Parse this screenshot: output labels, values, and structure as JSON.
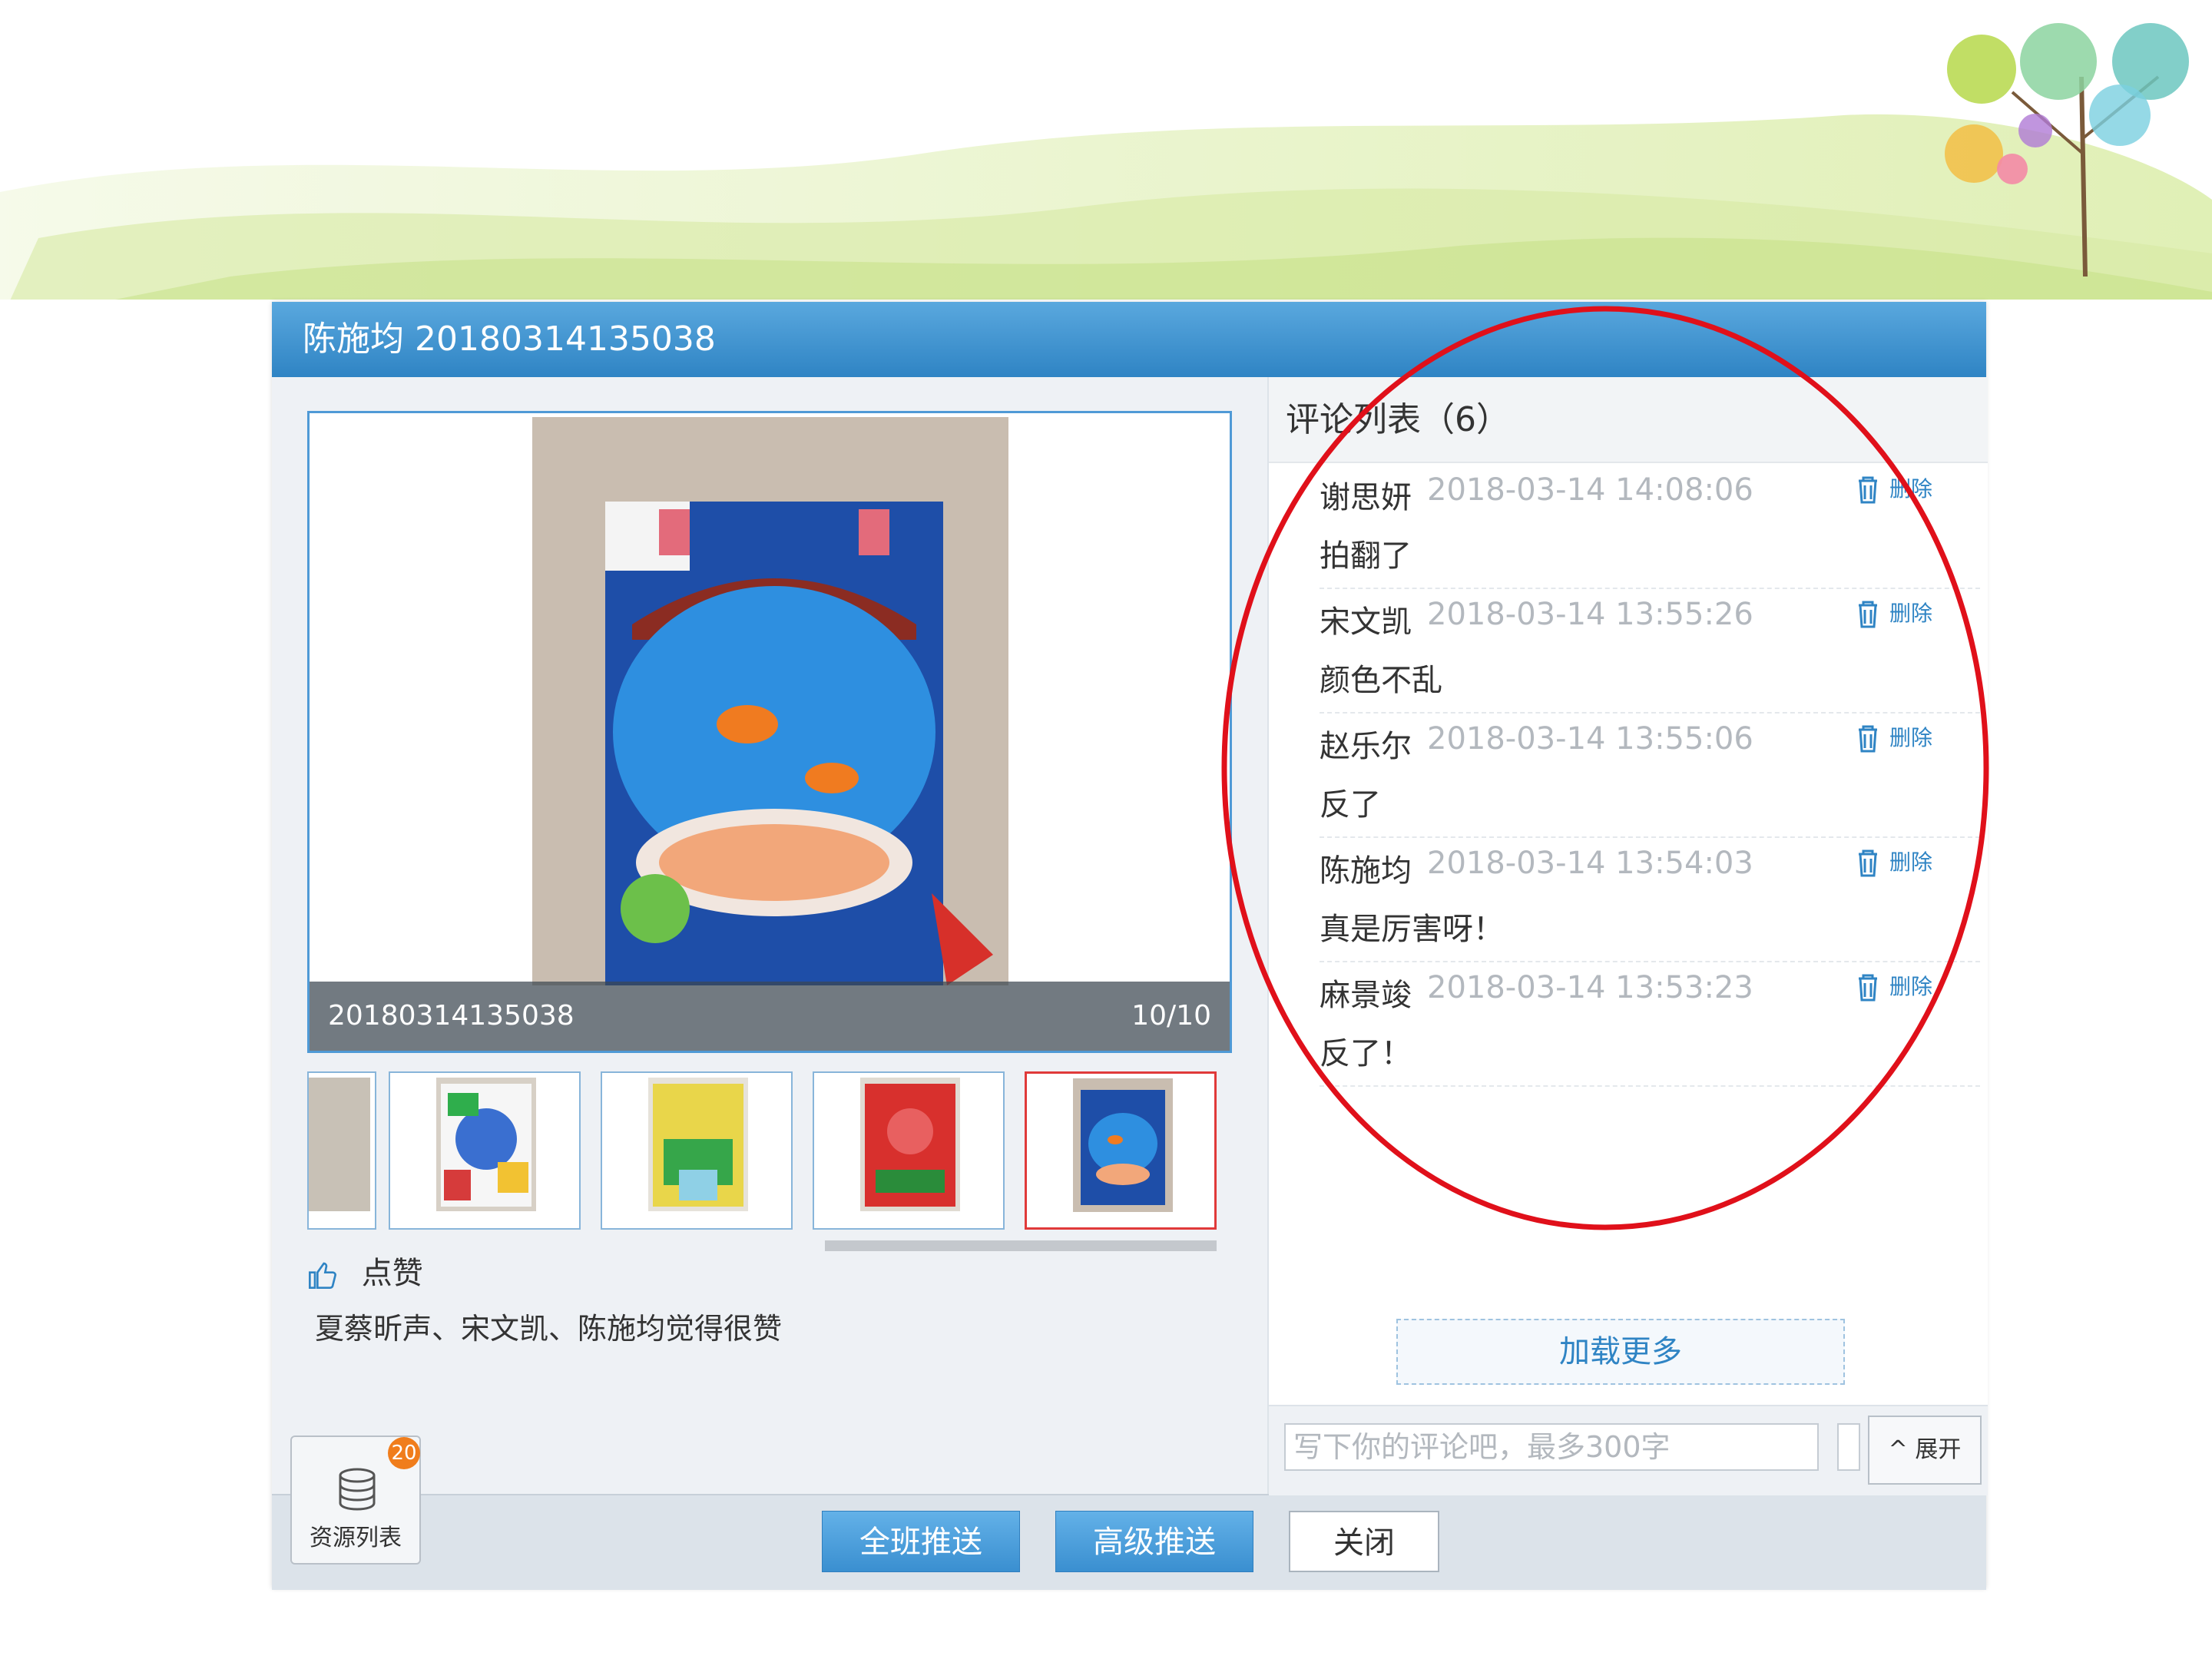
{
  "dialog": {
    "title": "陈施均 20180314135038"
  },
  "viewer": {
    "image_name": "20180314135038",
    "counter": "10/10"
  },
  "thumbnails": [
    {
      "label": "thumbnail-9"
    },
    {
      "label": "thumbnail-2"
    },
    {
      "label": "thumbnail-3"
    },
    {
      "label": "thumbnail-4"
    },
    {
      "label": "thumbnail-10",
      "selected": true
    }
  ],
  "likes": {
    "label": "点赞",
    "text": "夏蔡昕声、宋文凯、陈施均觉得很赞"
  },
  "resource": {
    "badge": "20",
    "label": "资源列表"
  },
  "actions": {
    "class_push": "全班推送",
    "advanced_push": "高级推送",
    "close": "关闭"
  },
  "comments": {
    "header": "评论列表（6）",
    "items": [
      {
        "author": "谢思妍",
        "time": "2018-03-14 14:08:06",
        "text": "拍翻了",
        "delete": "删除"
      },
      {
        "author": "宋文凯",
        "time": "2018-03-14 13:55:26",
        "text": "颜色不乱",
        "delete": "删除"
      },
      {
        "author": "赵乐尔",
        "time": "2018-03-14 13:55:06",
        "text": "反了",
        "delete": "删除"
      },
      {
        "author": "陈施均",
        "time": "2018-03-14 13:54:03",
        "text": "真是厉害呀！",
        "delete": "删除"
      },
      {
        "author": "麻景竣",
        "time": "2018-03-14 13:53:23",
        "text": "反了！",
        "delete": "删除"
      }
    ],
    "load_more": "加载更多",
    "input_placeholder": "写下你的评论吧，最多300字",
    "expand": "^ 展开"
  },
  "colors": {
    "header_blue": "#2f84c4",
    "annotation_red": "#e0101a",
    "badge_orange": "#f07d1c"
  },
  "icons": [
    "thumbs-up-icon",
    "trash-icon",
    "database-icon"
  ]
}
